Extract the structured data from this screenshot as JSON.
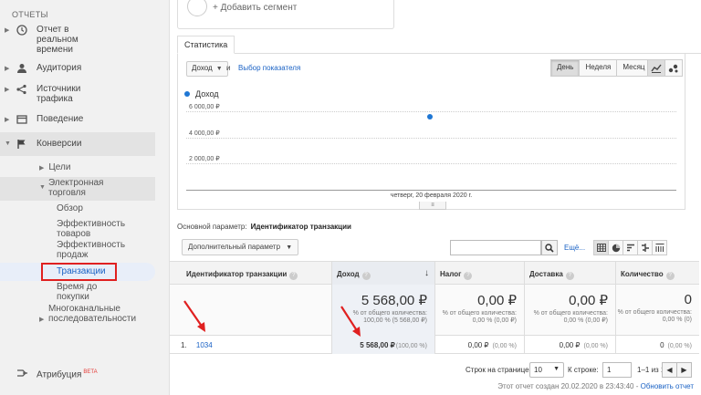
{
  "sidebar": {
    "heading": "ОТЧЕТЫ",
    "items": [
      {
        "label": "Отчет в реальном времени",
        "icon": "clock-icon"
      },
      {
        "label": "Аудитория",
        "icon": "person-icon"
      },
      {
        "label": "Источники трафика",
        "icon": "acquisition-icon"
      },
      {
        "label": "Поведение",
        "icon": "behavior-icon"
      },
      {
        "label": "Конверсии",
        "icon": "flag-icon"
      }
    ],
    "conversions": {
      "goals": "Цели",
      "ecommerce": "Электронная торговля",
      "overview": "Обзор",
      "product_perf": "Эффективность товаров",
      "sales_perf": "Эффективность продаж",
      "transactions": "Транзакции",
      "time_to_purchase": "Время до покупки",
      "multichannel": "Многоканальные последовательности"
    },
    "attribution": "Атрибуция",
    "beta": "BETA"
  },
  "segment": {
    "add_label": "+ Добавить сегмент"
  },
  "tabs": {
    "stats": "Статистика"
  },
  "chart_controls": {
    "metric": "Доход",
    "and": "и",
    "choose_metric": "Выбор показателя",
    "period_buttons": [
      "День",
      "Неделя",
      "Месяц"
    ],
    "active_period": "День"
  },
  "chart_data": {
    "type": "line",
    "series": [
      {
        "name": "Доход",
        "values": [
          5568
        ]
      }
    ],
    "x": [
      "четверг, 20 февраля 2020 г."
    ],
    "ytick_labels": [
      "6 000,00 ₽",
      "4 000,00 ₽",
      "2 000,00 ₽"
    ],
    "ylim": [
      0,
      7000
    ],
    "grid": true,
    "color": "#1f77d4"
  },
  "dimension": {
    "label": "Основной параметр:",
    "value": "Идентификатор транзакции"
  },
  "table_toolbar": {
    "secondary_dim": "Дополнительный параметр",
    "advanced": "Ещё..."
  },
  "table": {
    "headers": [
      "Идентификатор транзакции",
      "Доход",
      "Налог",
      "Доставка",
      "Количество"
    ],
    "totals": [
      {
        "value": "5 568,00 ₽",
        "sub": "% от общего количества: 100,00 % (5 568,00 ₽)"
      },
      {
        "value": "0,00 ₽",
        "sub": "% от общего количества: 0,00 % (0,00 ₽)"
      },
      {
        "value": "0,00 ₽",
        "sub": "% от общего количества: 0,00 % (0,00 ₽)"
      },
      {
        "value": "0",
        "sub": "% от общего количества: 0,00 % (0)"
      }
    ],
    "row": {
      "index": "1.",
      "id": "1034",
      "revenue": "5 568,00 ₽",
      "revenue_pct": "(100,00 %)",
      "tax": "0,00 ₽",
      "tax_pct": "(0,00 %)",
      "shipping": "0,00 ₽",
      "shipping_pct": "(0,00 %)",
      "qty": "0",
      "qty_pct": "(0,00 %)"
    }
  },
  "pager": {
    "rows_label": "Строк на странице:",
    "rows_value": "10",
    "goto_label": "К строке:",
    "goto_value": "1",
    "range": "1–1 из 1"
  },
  "footer": {
    "text": "Этот отчет создан 20.02.2020 в 23:43:40 - ",
    "refresh": "Обновить отчет"
  }
}
